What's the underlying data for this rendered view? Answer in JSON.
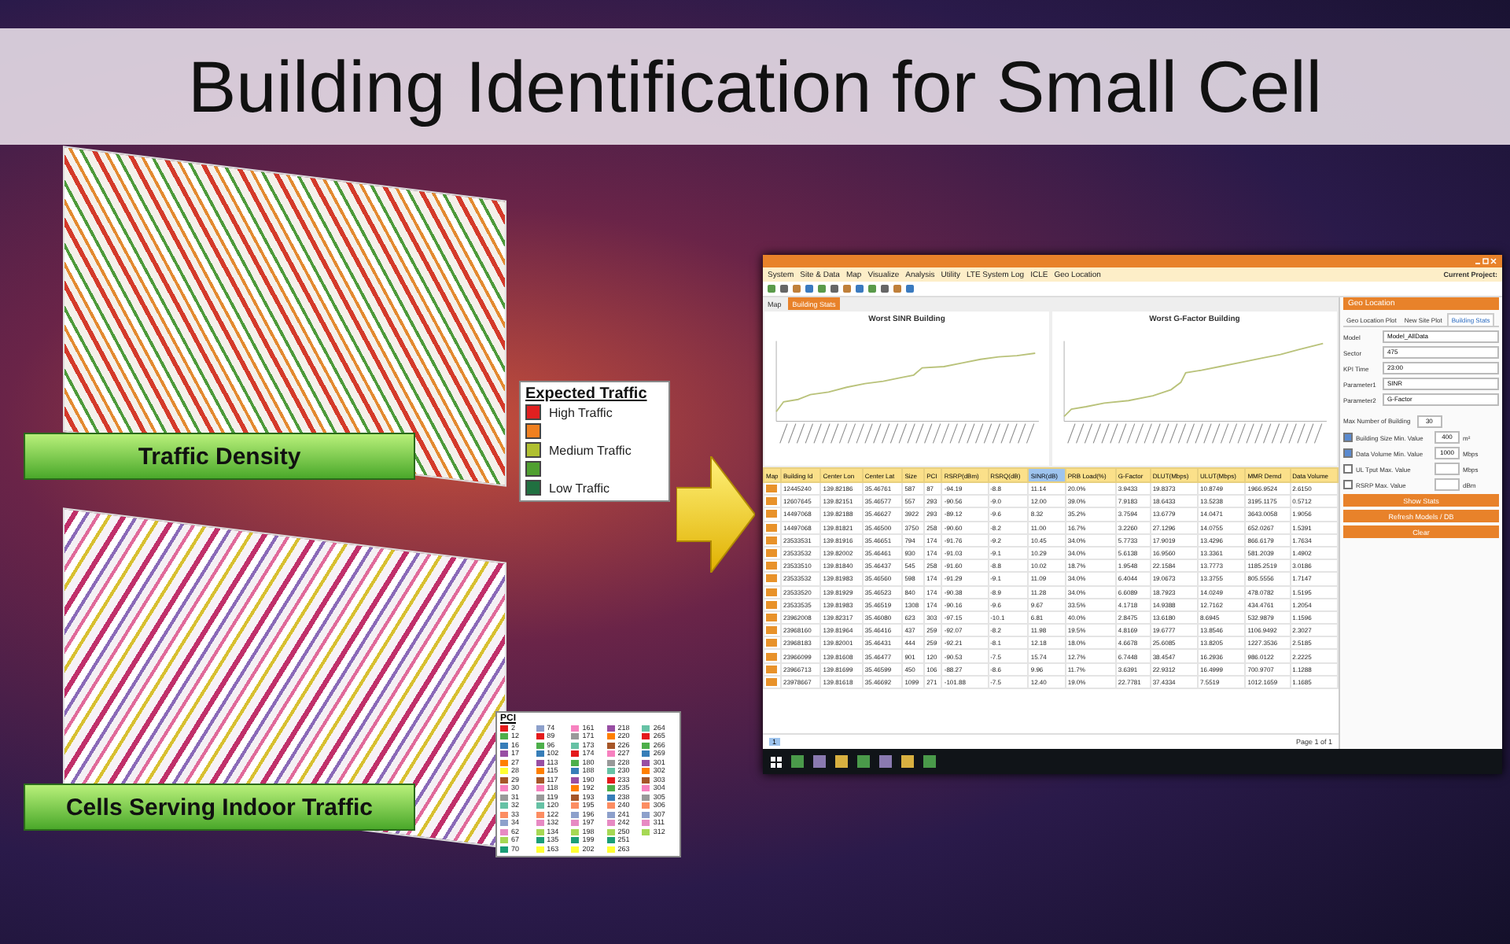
{
  "title": "Building Identification for Small Cell",
  "maps": [
    {
      "kind": "traffic",
      "caption": "Traffic Density"
    },
    {
      "kind": "pci",
      "caption": "Cells Serving Indoor Traffic"
    }
  ],
  "traffic_legend": {
    "title": "Expected Traffic",
    "items": [
      {
        "label": "High Traffic",
        "color": "#e02020"
      },
      {
        "color": "#f08020"
      },
      {
        "label": "Medium Traffic",
        "color": "#b0c030"
      },
      {
        "color": "#50a030"
      },
      {
        "label": "Low Traffic",
        "color": "#207040"
      }
    ]
  },
  "pci_legend": {
    "title": "PCI",
    "columns": [
      [
        {
          "label": "2",
          "color": "#e41a1c"
        },
        {
          "label": "12",
          "color": "#4daf4a"
        },
        {
          "label": "16",
          "color": "#377eb8"
        },
        {
          "label": "17",
          "color": "#984ea3"
        },
        {
          "label": "27",
          "color": "#ff7f00"
        },
        {
          "label": "28",
          "color": "#ffff33"
        },
        {
          "label": "29",
          "color": "#a65628"
        },
        {
          "label": "30",
          "color": "#f781bf"
        },
        {
          "label": "31",
          "color": "#999999"
        },
        {
          "label": "32",
          "color": "#66c2a5"
        },
        {
          "label": "33",
          "color": "#fc8d62"
        },
        {
          "label": "34",
          "color": "#8da0cb"
        },
        {
          "label": "62",
          "color": "#e78ac3"
        },
        {
          "label": "67",
          "color": "#a6d854"
        },
        {
          "label": "70",
          "color": "#1b9e77"
        }
      ],
      [
        {
          "label": "74",
          "color": "#8da0cb"
        },
        {
          "label": "89",
          "color": "#e41a1c"
        },
        {
          "label": "96",
          "color": "#4daf4a"
        },
        {
          "label": "102",
          "color": "#377eb8"
        },
        {
          "label": "113",
          "color": "#984ea3"
        },
        {
          "label": "115",
          "color": "#ff7f00"
        },
        {
          "label": "117",
          "color": "#a65628"
        },
        {
          "label": "118",
          "color": "#f781bf"
        },
        {
          "label": "119",
          "color": "#999999"
        },
        {
          "label": "120",
          "color": "#66c2a5"
        },
        {
          "label": "122",
          "color": "#fc8d62"
        },
        {
          "label": "132",
          "color": "#e78ac3"
        },
        {
          "label": "134",
          "color": "#a6d854"
        },
        {
          "label": "135",
          "color": "#1b9e77"
        },
        {
          "label": "163",
          "color": "#ffff33"
        }
      ],
      [
        {
          "label": "161",
          "color": "#f781bf"
        },
        {
          "label": "171",
          "color": "#999999"
        },
        {
          "label": "173",
          "color": "#66c2a5"
        },
        {
          "label": "174",
          "color": "#e41a1c"
        },
        {
          "label": "180",
          "color": "#4daf4a"
        },
        {
          "label": "188",
          "color": "#377eb8"
        },
        {
          "label": "190",
          "color": "#984ea3"
        },
        {
          "label": "192",
          "color": "#ff7f00"
        },
        {
          "label": "193",
          "color": "#a65628"
        },
        {
          "label": "195",
          "color": "#fc8d62"
        },
        {
          "label": "196",
          "color": "#8da0cb"
        },
        {
          "label": "197",
          "color": "#e78ac3"
        },
        {
          "label": "198",
          "color": "#a6d854"
        },
        {
          "label": "199",
          "color": "#1b9e77"
        },
        {
          "label": "202",
          "color": "#ffff33"
        }
      ],
      [
        {
          "label": "218",
          "color": "#984ea3"
        },
        {
          "label": "220",
          "color": "#ff7f00"
        },
        {
          "label": "226",
          "color": "#a65628"
        },
        {
          "label": "227",
          "color": "#f781bf"
        },
        {
          "label": "228",
          "color": "#999999"
        },
        {
          "label": "230",
          "color": "#66c2a5"
        },
        {
          "label": "233",
          "color": "#e41a1c"
        },
        {
          "label": "235",
          "color": "#4daf4a"
        },
        {
          "label": "238",
          "color": "#377eb8"
        },
        {
          "label": "240",
          "color": "#fc8d62"
        },
        {
          "label": "241",
          "color": "#8da0cb"
        },
        {
          "label": "242",
          "color": "#e78ac3"
        },
        {
          "label": "250",
          "color": "#a6d854"
        },
        {
          "label": "251",
          "color": "#1b9e77"
        },
        {
          "label": "263",
          "color": "#ffff33"
        }
      ],
      [
        {
          "label": "264",
          "color": "#66c2a5"
        },
        {
          "label": "265",
          "color": "#e41a1c"
        },
        {
          "label": "266",
          "color": "#4daf4a"
        },
        {
          "label": "269",
          "color": "#377eb8"
        },
        {
          "label": "301",
          "color": "#984ea3"
        },
        {
          "label": "302",
          "color": "#ff7f00"
        },
        {
          "label": "303",
          "color": "#a65628"
        },
        {
          "label": "304",
          "color": "#f781bf"
        },
        {
          "label": "305",
          "color": "#999999"
        },
        {
          "label": "306",
          "color": "#fc8d62"
        },
        {
          "label": "307",
          "color": "#8da0cb"
        },
        {
          "label": "311",
          "color": "#e78ac3"
        },
        {
          "label": "312",
          "color": "#a6d854"
        }
      ]
    ]
  },
  "app": {
    "menu": [
      "System",
      "Site & Data",
      "Map",
      "Visualize",
      "Analysis",
      "Utility",
      "LTE System Log",
      "ICLE",
      "Geo Location"
    ],
    "project_label": "Current Project:",
    "tabs": [
      {
        "label": "Map",
        "selected": false
      },
      {
        "label": "Building Stats",
        "selected": true
      }
    ],
    "charts": [
      {
        "title": "Worst SINR Building",
        "kind": "sinr"
      },
      {
        "title": "Worst G-Factor Building",
        "kind": "gfactor"
      }
    ],
    "table": {
      "columns": [
        {
          "label": "Map",
          "selected": false
        },
        {
          "label": "Building Id",
          "selected": false
        },
        {
          "label": "Center Lon",
          "selected": false
        },
        {
          "label": "Center Lat",
          "selected": false
        },
        {
          "label": "Size",
          "selected": false
        },
        {
          "label": "PCI",
          "selected": false
        },
        {
          "label": "RSRP(dBm)",
          "selected": false
        },
        {
          "label": "RSRQ(dB)",
          "selected": false
        },
        {
          "label": "SINR(dB)",
          "selected": true
        },
        {
          "label": "PRB Load(%)",
          "selected": false
        },
        {
          "label": "G-Factor",
          "selected": false
        },
        {
          "label": "DLUT(Mbps)",
          "selected": false
        },
        {
          "label": "ULUT(Mbps)",
          "selected": false
        },
        {
          "label": "MMR Demd",
          "selected": false
        },
        {
          "label": "Data Volume",
          "selected": false
        }
      ],
      "rows": [
        [
          "",
          "12445240",
          "139.82186",
          "35.46761",
          "587",
          "87",
          "-94.19",
          "-8.8",
          "11.14",
          "20.0%",
          "3.9433",
          "19.8373",
          "10.8749",
          "1966.9524",
          "2.6150"
        ],
        [
          "",
          "12607645",
          "139.82151",
          "35.46577",
          "557",
          "293",
          "-90.56",
          "-9.0",
          "12.00",
          "39.0%",
          "7.9183",
          "18.6433",
          "13.5238",
          "3195.1175",
          "0.5712"
        ],
        [
          "",
          "14497068",
          "139.82188",
          "35.46627",
          "3922",
          "293",
          "-89.12",
          "-9.6",
          "8.32",
          "35.2%",
          "3.7594",
          "13.6779",
          "14.0471",
          "3643.0058",
          "1.9056"
        ],
        [
          "",
          "14497068",
          "139.81821",
          "35.46500",
          "3750",
          "258",
          "-90.60",
          "-8.2",
          "11.00",
          "16.7%",
          "3.2260",
          "27.1296",
          "14.0755",
          "652.0267",
          "1.5391"
        ],
        [
          "",
          "23533531",
          "139.81916",
          "35.46651",
          "794",
          "174",
          "-91.76",
          "-9.2",
          "10.45",
          "34.0%",
          "5.7733",
          "17.9019",
          "13.4296",
          "866.6179",
          "1.7634"
        ],
        [
          "",
          "23533532",
          "139.82002",
          "35.46461",
          "930",
          "174",
          "-91.03",
          "-9.1",
          "10.29",
          "34.0%",
          "5.6138",
          "16.9560",
          "13.3361",
          "581.2039",
          "1.4902"
        ],
        [
          "",
          "23533510",
          "139.81840",
          "35.46437",
          "545",
          "258",
          "-91.60",
          "-8.8",
          "10.02",
          "18.7%",
          "1.9548",
          "22.1584",
          "13.7773",
          "1185.2519",
          "3.0186"
        ],
        [
          "",
          "23533532",
          "139.81983",
          "35.46560",
          "598",
          "174",
          "-91.29",
          "-9.1",
          "11.09",
          "34.0%",
          "6.4044",
          "19.0673",
          "13.3755",
          "805.5556",
          "1.7147"
        ],
        [
          "",
          "23533520",
          "139.81929",
          "35.46523",
          "840",
          "174",
          "-90.38",
          "-8.9",
          "11.28",
          "34.0%",
          "6.6089",
          "18.7923",
          "14.0249",
          "478.0782",
          "1.5195"
        ],
        [
          "",
          "23533535",
          "139.81983",
          "35.46519",
          "1308",
          "174",
          "-90.16",
          "-9.6",
          "9.67",
          "33.5%",
          "4.1718",
          "14.9388",
          "12.7162",
          "434.4761",
          "1.2054"
        ],
        [
          "",
          "23962008",
          "139.82317",
          "35.46080",
          "623",
          "303",
          "-97.15",
          "-10.1",
          "6.81",
          "40.0%",
          "2.8475",
          "13.6180",
          "8.6945",
          "532.9879",
          "1.1596"
        ],
        [
          "",
          "23968160",
          "139.81964",
          "35.46416",
          "437",
          "259",
          "-92.07",
          "-8.2",
          "11.98",
          "19.5%",
          "4.8169",
          "19.6777",
          "13.8546",
          "1106.9492",
          "2.3027"
        ],
        [
          "",
          "23968183",
          "139.82001",
          "35.46431",
          "444",
          "259",
          "-92.21",
          "-8.1",
          "12.18",
          "18.0%",
          "4.6678",
          "25.6085",
          "13.8205",
          "1227.3536",
          "2.5185"
        ],
        [
          "",
          "23966099",
          "139.81608",
          "35.46477",
          "901",
          "120",
          "-90.53",
          "-7.5",
          "15.74",
          "12.7%",
          "6.7448",
          "38.4547",
          "16.2936",
          "986.0122",
          "2.2225"
        ],
        [
          "",
          "23966713",
          "139.81699",
          "35.46599",
          "450",
          "106",
          "-88.27",
          "-8.6",
          "9.96",
          "11.7%",
          "3.6391",
          "22.9312",
          "16.4999",
          "700.9707",
          "1.1288"
        ],
        [
          "",
          "23978667",
          "139.81618",
          "35.46692",
          "1099",
          "271",
          "-101.88",
          "-7.5",
          "12.40",
          "19.0%",
          "22.7781",
          "37.4334",
          "7.5519",
          "1012.1659",
          "1.1685"
        ]
      ]
    },
    "pager": {
      "page": "1",
      "summary": "Page 1 of 1"
    },
    "panel": {
      "header": "Geo Location",
      "tabs": [
        {
          "label": "Geo Location Plot",
          "selected": false
        },
        {
          "label": "New Site Plot",
          "selected": false
        },
        {
          "label": "Building Stats",
          "selected": true
        }
      ],
      "fields": [
        {
          "label": "Model",
          "value": "Model_AllData"
        },
        {
          "label": "Sector",
          "value": "475"
        },
        {
          "label": "KPI Time",
          "value": "23:00"
        },
        {
          "label": "Parameter1",
          "value": "SINR"
        },
        {
          "label": "Parameter2",
          "value": "G-Factor"
        }
      ],
      "max_buildings": {
        "label": "Max Number of Building",
        "value": "30"
      },
      "options": [
        {
          "label": "Building Size Min. Value",
          "value": "400",
          "unit": "m²",
          "checked": true
        },
        {
          "label": "Data Volume Min. Value",
          "value": "1000",
          "unit": "Mbps",
          "checked": true
        },
        {
          "label": "UL Tput Max. Value",
          "unit": "Mbps",
          "checked": false
        },
        {
          "label": "RSRP Max. Value",
          "unit": "dBm",
          "checked": false
        }
      ],
      "buttons": [
        "Show Stats",
        "Refresh Models / DB",
        "Clear"
      ]
    }
  }
}
